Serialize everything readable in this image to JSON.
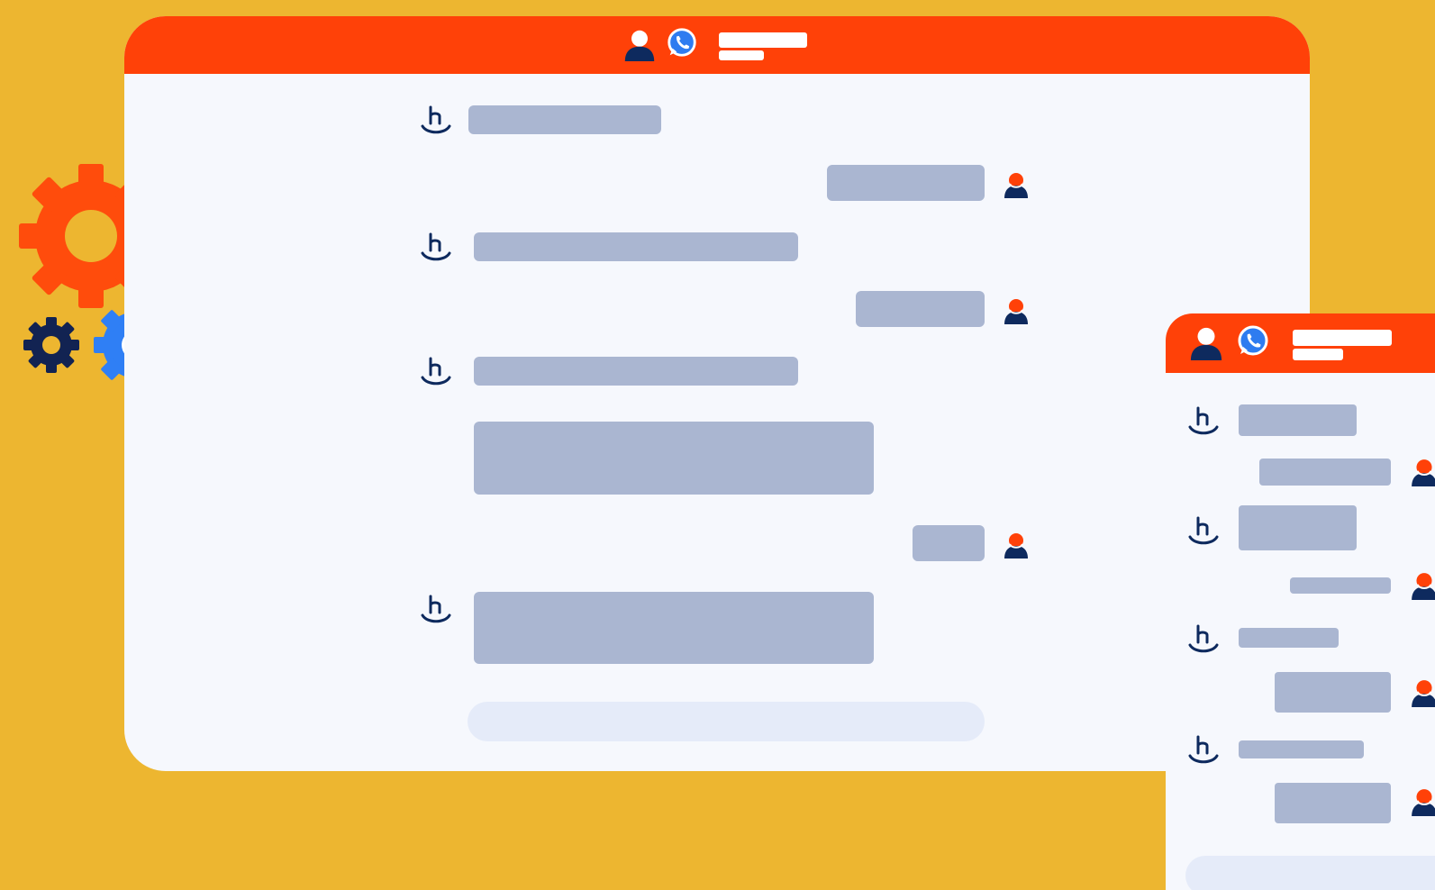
{
  "colors": {
    "background": "#EDB630",
    "header": "#FF4108",
    "window_body": "#F6F8FD",
    "bubble": "#AAB6D1",
    "input": "#E5EBF9",
    "navy": "#0E2A5E",
    "whatsapp_blue": "#2E7CF0",
    "gear_orange": "#FF4C0C",
    "gear_navy": "#122352",
    "gear_blue": "#2F7FF5",
    "white": "#FFFFFF"
  },
  "icons": {
    "header_avatar": "avatar-icon",
    "header_chat": "whatsapp-icon",
    "bot": "bot-logo-icon",
    "user": "user-avatar-icon",
    "gears": "gear-icon"
  },
  "main_window": {
    "messages": [
      {
        "from": "bot",
        "lines": 1
      },
      {
        "from": "user",
        "lines": 1
      },
      {
        "from": "bot",
        "lines": 1
      },
      {
        "from": "user",
        "lines": 1
      },
      {
        "from": "bot",
        "lines": 1
      },
      {
        "from": "bot",
        "lines": 2
      },
      {
        "from": "user",
        "lines": 1
      },
      {
        "from": "bot",
        "lines": 2
      }
    ]
  },
  "side_window": {
    "messages": [
      {
        "from": "bot",
        "lines": 1
      },
      {
        "from": "user",
        "lines": 1
      },
      {
        "from": "bot",
        "lines": 1
      },
      {
        "from": "user",
        "lines": 1
      },
      {
        "from": "bot",
        "lines": 1
      },
      {
        "from": "user",
        "lines": 1
      },
      {
        "from": "bot",
        "lines": 1
      },
      {
        "from": "user",
        "lines": 1
      }
    ]
  }
}
